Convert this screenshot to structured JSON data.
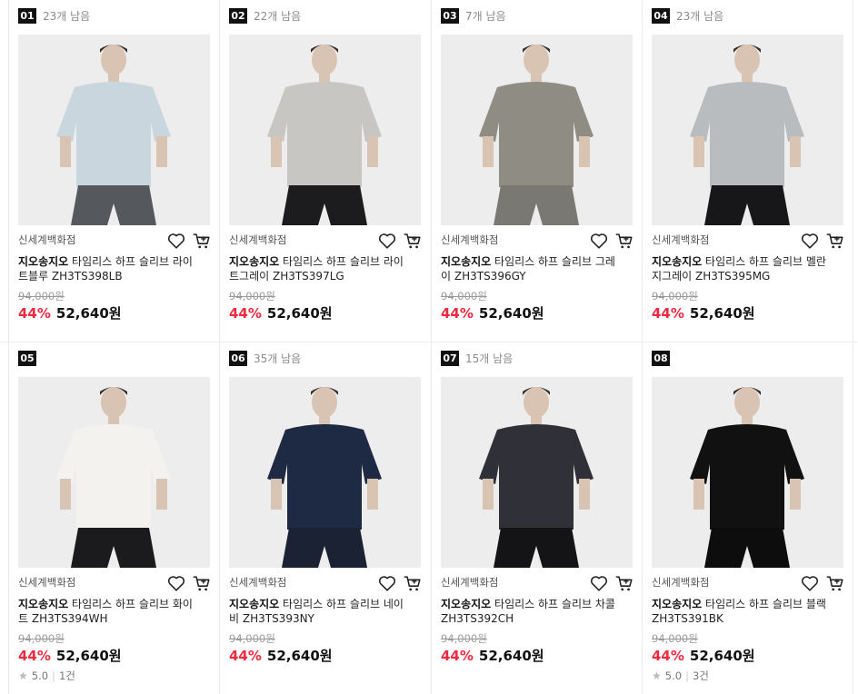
{
  "store_label": "신세계백화점",
  "brand": "지오송지오",
  "colors": {
    "accent_red": "#f0293e",
    "thumb_bg": "#ededed"
  },
  "icons": {
    "wishlist": "heart-icon",
    "cart": "cart-icon",
    "rating": "star-icon"
  },
  "products": [
    {
      "rank": "01",
      "stock": "23개 남음",
      "title": "타임리스 하프 슬리브 라이트블루 ZH3TS398LB",
      "original_price": "94,000원",
      "discount": "44%",
      "sale_price": "52,640원",
      "shirt_color": "#c9d6de",
      "pants_color": "#55585c",
      "rating": "",
      "reviews": ""
    },
    {
      "rank": "02",
      "stock": "22개 남음",
      "title": "타임리스 하프 슬리브 라이트그레이 ZH3TS397LG",
      "original_price": "94,000원",
      "discount": "44%",
      "sale_price": "52,640원",
      "shirt_color": "#c8c6c2",
      "pants_color": "#1c1c1e",
      "rating": "",
      "reviews": ""
    },
    {
      "rank": "03",
      "stock": "7개 남음",
      "title": "타임리스 하프 슬리브 그레이 ZH3TS396GY",
      "original_price": "94,000원",
      "discount": "44%",
      "sale_price": "52,640원",
      "shirt_color": "#8f8c84",
      "pants_color": "#7a7873",
      "rating": "",
      "reviews": ""
    },
    {
      "rank": "04",
      "stock": "23개 남음",
      "title": "타임리스 하프 슬리브 멜란지그레이 ZH3TS395MG",
      "original_price": "94,000원",
      "discount": "44%",
      "sale_price": "52,640원",
      "shirt_color": "#b9bcbe",
      "pants_color": "#17171a",
      "rating": "",
      "reviews": ""
    },
    {
      "rank": "05",
      "stock": "",
      "title": "타임리스 하프 슬리브 화이트 ZH3TS394WH",
      "original_price": "94,000원",
      "discount": "44%",
      "sale_price": "52,640원",
      "shirt_color": "#f3f2ef",
      "pants_color": "#1b1b1d",
      "rating": "5.0",
      "reviews": "1건"
    },
    {
      "rank": "06",
      "stock": "35개 남음",
      "title": "타임리스 하프 슬리브 네이비 ZH3TS393NY",
      "original_price": "94,000원",
      "discount": "44%",
      "sale_price": "52,640원",
      "shirt_color": "#1e2a44",
      "pants_color": "#1a2233",
      "rating": "",
      "reviews": ""
    },
    {
      "rank": "07",
      "stock": "15개 남음",
      "title": "타임리스 하프 슬리브 차콜 ZH3TS392CH",
      "original_price": "94,000원",
      "discount": "44%",
      "sale_price": "52,640원",
      "shirt_color": "#2f3038",
      "pants_color": "#141416",
      "rating": "",
      "reviews": ""
    },
    {
      "rank": "08",
      "stock": "",
      "title": "타임리스 하프 슬리브 블랙 ZH3TS391BK",
      "original_price": "94,000원",
      "discount": "44%",
      "sale_price": "52,640원",
      "shirt_color": "#111112",
      "pants_color": "#0d0d0e",
      "rating": "5.0",
      "reviews": "3건"
    }
  ]
}
